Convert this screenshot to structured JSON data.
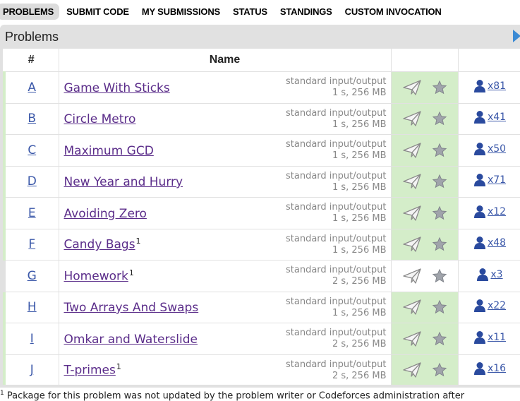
{
  "nav": {
    "tabs": [
      {
        "label": "PROBLEMS",
        "active": true
      },
      {
        "label": "SUBMIT CODE",
        "active": false
      },
      {
        "label": "MY SUBMISSIONS",
        "active": false
      },
      {
        "label": "STATUS",
        "active": false
      },
      {
        "label": "STANDINGS",
        "active": false
      },
      {
        "label": "CUSTOM INVOCATION",
        "active": false
      }
    ]
  },
  "panel": {
    "title": "Problems"
  },
  "table": {
    "headers": {
      "id": "#",
      "name": "Name"
    },
    "rows": [
      {
        "id": "A",
        "name": "Game With Sticks",
        "sup": "",
        "io": "standard input/output",
        "limits": "1 s, 256 MB",
        "solved_count": "x81",
        "accepted": true
      },
      {
        "id": "B",
        "name": "Circle Metro",
        "sup": "",
        "io": "standard input/output",
        "limits": "1 s, 256 MB",
        "solved_count": "x41",
        "accepted": true
      },
      {
        "id": "C",
        "name": "Maximum GCD",
        "sup": "",
        "io": "standard input/output",
        "limits": "1 s, 256 MB",
        "solved_count": "x50",
        "accepted": true
      },
      {
        "id": "D",
        "name": "New Year and Hurry",
        "sup": "",
        "io": "standard input/output",
        "limits": "1 s, 256 MB",
        "solved_count": "x71",
        "accepted": true
      },
      {
        "id": "E",
        "name": "Avoiding Zero",
        "sup": "",
        "io": "standard input/output",
        "limits": "1 s, 256 MB",
        "solved_count": "x12",
        "accepted": true
      },
      {
        "id": "F",
        "name": "Candy Bags",
        "sup": "1",
        "io": "standard input/output",
        "limits": "1 s, 256 MB",
        "solved_count": "x48",
        "accepted": true
      },
      {
        "id": "G",
        "name": "Homework",
        "sup": "1",
        "io": "standard input/output",
        "limits": "2 s, 256 MB",
        "solved_count": "x3",
        "accepted": false
      },
      {
        "id": "H",
        "name": "Two Arrays And Swaps",
        "sup": "",
        "io": "standard input/output",
        "limits": "1 s, 256 MB",
        "solved_count": "x22",
        "accepted": true
      },
      {
        "id": "I",
        "name": "Omkar and Waterslide",
        "sup": "",
        "io": "standard input/output",
        "limits": "2 s, 256 MB",
        "solved_count": "x11",
        "accepted": true
      },
      {
        "id": "J",
        "name": "T-primes",
        "sup": "1",
        "io": "standard input/output",
        "limits": "2 s, 256 MB",
        "solved_count": "x16",
        "accepted": true
      }
    ]
  },
  "footnote": {
    "marker": "1",
    "text": " Package for this problem was not updated by the problem writer or Codeforces administration after"
  },
  "colors": {
    "accepted_bg": "#d4edc9",
    "link_blue": "#3b58a9",
    "name_purple": "#5b2d8a",
    "panel_gray": "#e1e1e1",
    "arrow_blue": "#3b8ad4"
  },
  "icons": {
    "submit": "paper-plane-icon",
    "favorite": "star-icon",
    "solvers": "user-icon",
    "panel_toggle": "triangle-right-icon"
  }
}
